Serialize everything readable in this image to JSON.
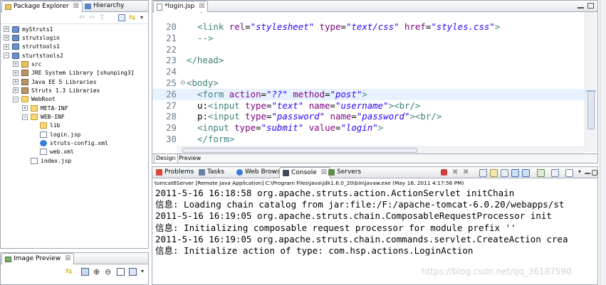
{
  "package_explorer": {
    "tabs": [
      {
        "label": "Package Explorer",
        "close": "☒"
      },
      {
        "label": "Hierarchy",
        "close": ""
      }
    ],
    "tree": [
      {
        "label": "myStruts1",
        "level": 0,
        "expander": "+",
        "icon": "project"
      },
      {
        "label": "strutslogin",
        "level": 0,
        "expander": "+",
        "icon": "project"
      },
      {
        "label": "struttools1",
        "level": 0,
        "expander": "+",
        "icon": "project"
      },
      {
        "label": "sturtstools2",
        "level": 0,
        "expander": "−",
        "icon": "project"
      },
      {
        "label": "src",
        "level": 1,
        "expander": "+",
        "icon": "src"
      },
      {
        "label": "JRE System Library [shunping3]",
        "level": 1,
        "expander": "+",
        "icon": "library"
      },
      {
        "label": "Java EE 5 Libraries",
        "level": 1,
        "expander": "+",
        "icon": "library"
      },
      {
        "label": "Struts 1.3 Libraries",
        "level": 1,
        "expander": "+",
        "icon": "library"
      },
      {
        "label": "WebRoot",
        "level": 1,
        "expander": "−",
        "icon": "folder"
      },
      {
        "label": "META-INF",
        "level": 2,
        "expander": "+",
        "icon": "folder"
      },
      {
        "label": "WEB-INF",
        "level": 2,
        "expander": "−",
        "icon": "folder"
      },
      {
        "label": "lib",
        "level": 3,
        "expander": "",
        "icon": "folder"
      },
      {
        "label": "login.jsp",
        "level": 3,
        "expander": "",
        "icon": "file"
      },
      {
        "label": "struts-config.xml",
        "level": 3,
        "expander": "",
        "icon": "cog"
      },
      {
        "label": "web.xml",
        "level": 3,
        "expander": "",
        "icon": "xml"
      },
      {
        "label": "index.jsp",
        "level": 2,
        "expander": "",
        "icon": "file"
      }
    ]
  },
  "image_preview": {
    "tab_label": "Image Preview",
    "close": "☒"
  },
  "editor": {
    "tab_label": "*login.jsp",
    "close": "☒",
    "lines": [
      {
        "num": "20",
        "code": [
          {
            "t": "<link ",
            "c": "tag"
          },
          {
            "t": "rel",
            "c": "attr"
          },
          {
            "t": "=",
            "c": ""
          },
          {
            "t": "\"stylesheet\"",
            "c": "str"
          },
          {
            "t": " ",
            "c": ""
          },
          {
            "t": "type",
            "c": "attr"
          },
          {
            "t": "=",
            "c": ""
          },
          {
            "t": "\"text/css\"",
            "c": "str"
          },
          {
            "t": " ",
            "c": ""
          },
          {
            "t": "href",
            "c": "attr"
          },
          {
            "t": "=",
            "c": ""
          },
          {
            "t": "\"styles.css\"",
            "c": "str"
          },
          {
            "t": ">",
            "c": "tag"
          }
        ],
        "indent": 1
      },
      {
        "num": "21",
        "code": [
          {
            "t": "-->",
            "c": "tag"
          }
        ],
        "indent": 1
      },
      {
        "num": "22",
        "code": [],
        "indent": 0
      },
      {
        "num": "23",
        "code": [
          {
            "t": "</head>",
            "c": "tag"
          }
        ],
        "indent": 0
      },
      {
        "num": "24",
        "code": [],
        "indent": 0
      },
      {
        "num": "25",
        "code": [
          {
            "t": "<body>",
            "c": "tag"
          }
        ],
        "indent": 0
      },
      {
        "num": "26",
        "code": [
          {
            "t": "<form ",
            "c": "tag"
          },
          {
            "t": "action",
            "c": "attr"
          },
          {
            "t": "=",
            "c": ""
          },
          {
            "t": "\"??\"",
            "c": "str"
          },
          {
            "t": " ",
            "c": ""
          },
          {
            "t": "method",
            "c": "attr"
          },
          {
            "t": "=",
            "c": ""
          },
          {
            "t": "\"post\"",
            "c": "str"
          },
          {
            "t": ">",
            "c": "tag"
          }
        ],
        "indent": 1
      },
      {
        "num": "27",
        "code": [
          {
            "t": "u:",
            "c": ""
          },
          {
            "t": "<input ",
            "c": "tag"
          },
          {
            "t": "type",
            "c": "attr"
          },
          {
            "t": "=",
            "c": ""
          },
          {
            "t": "\"text\"",
            "c": "str"
          },
          {
            "t": " ",
            "c": ""
          },
          {
            "t": "name",
            "c": "attr"
          },
          {
            "t": "=",
            "c": ""
          },
          {
            "t": "\"username\"",
            "c": "str"
          },
          {
            "t": "><br/>",
            "c": "tag"
          }
        ],
        "indent": 1
      },
      {
        "num": "28",
        "code": [
          {
            "t": "p:",
            "c": ""
          },
          {
            "t": "<input ",
            "c": "tag"
          },
          {
            "t": "type",
            "c": "attr"
          },
          {
            "t": "=",
            "c": ""
          },
          {
            "t": "\"password\"",
            "c": "str"
          },
          {
            "t": " ",
            "c": ""
          },
          {
            "t": "name",
            "c": "attr"
          },
          {
            "t": "=",
            "c": ""
          },
          {
            "t": "\"password\"",
            "c": "str"
          },
          {
            "t": "><br/>",
            "c": "tag"
          }
        ],
        "indent": 1
      },
      {
        "num": "29",
        "code": [
          {
            "t": "<input ",
            "c": "tag"
          },
          {
            "t": "type",
            "c": "attr"
          },
          {
            "t": "=",
            "c": ""
          },
          {
            "t": "\"submit\"",
            "c": "str"
          },
          {
            "t": " ",
            "c": ""
          },
          {
            "t": "value",
            "c": "attr"
          },
          {
            "t": "=",
            "c": ""
          },
          {
            "t": "\"login\"",
            "c": "str"
          },
          {
            "t": ">",
            "c": "tag"
          }
        ],
        "indent": 1
      },
      {
        "num": "30",
        "code": [
          {
            "t": "</form>",
            "c": "tag"
          }
        ],
        "indent": 1
      }
    ],
    "bottom_tabs": [
      "Design",
      "Preview"
    ]
  },
  "console_view": {
    "tabs": [
      {
        "label": "Problems",
        "icon": "problems-icon"
      },
      {
        "label": "Tasks",
        "icon": "tasks-icon"
      },
      {
        "label": "Web Browser",
        "icon": "globe-icon"
      },
      {
        "label": "Console",
        "icon": "console-icon",
        "close": "☒"
      },
      {
        "label": "Servers",
        "icon": "servers-icon"
      }
    ],
    "header": "tomcat6Server [Remote Java Application] C:\\Program Files\\Java\\jdk1.6.0_20\\bin\\javaw.exe (May 16, 2011 4:17:56 PM)",
    "lines": [
      "2011-5-16 16:18:58 org.apache.struts.action.ActionServlet initChain",
      "信息: Loading chain catalog from jar:file:/F:/apache-tomcat-6.0.20/webapps/st",
      "2011-5-16 16:19:05 org.apache.struts.chain.ComposableRequestProcessor init",
      "信息: Initializing composable request processor for module prefix ''",
      "2011-5-16 16:19:05 org.apache.struts.chain.commands.servlet.CreateAction crea",
      "信息: Initialize action of type: com.hsp.actions.LoginAction"
    ],
    "watermark": "https://blog.csdn.net/qq_36187590"
  },
  "colors": {
    "tag": "#3f7f7f",
    "attribute": "#7f007f",
    "string": "#2a00ff",
    "line_highlight": "#e8f2fe",
    "terminate_red": "#d33c3c"
  }
}
